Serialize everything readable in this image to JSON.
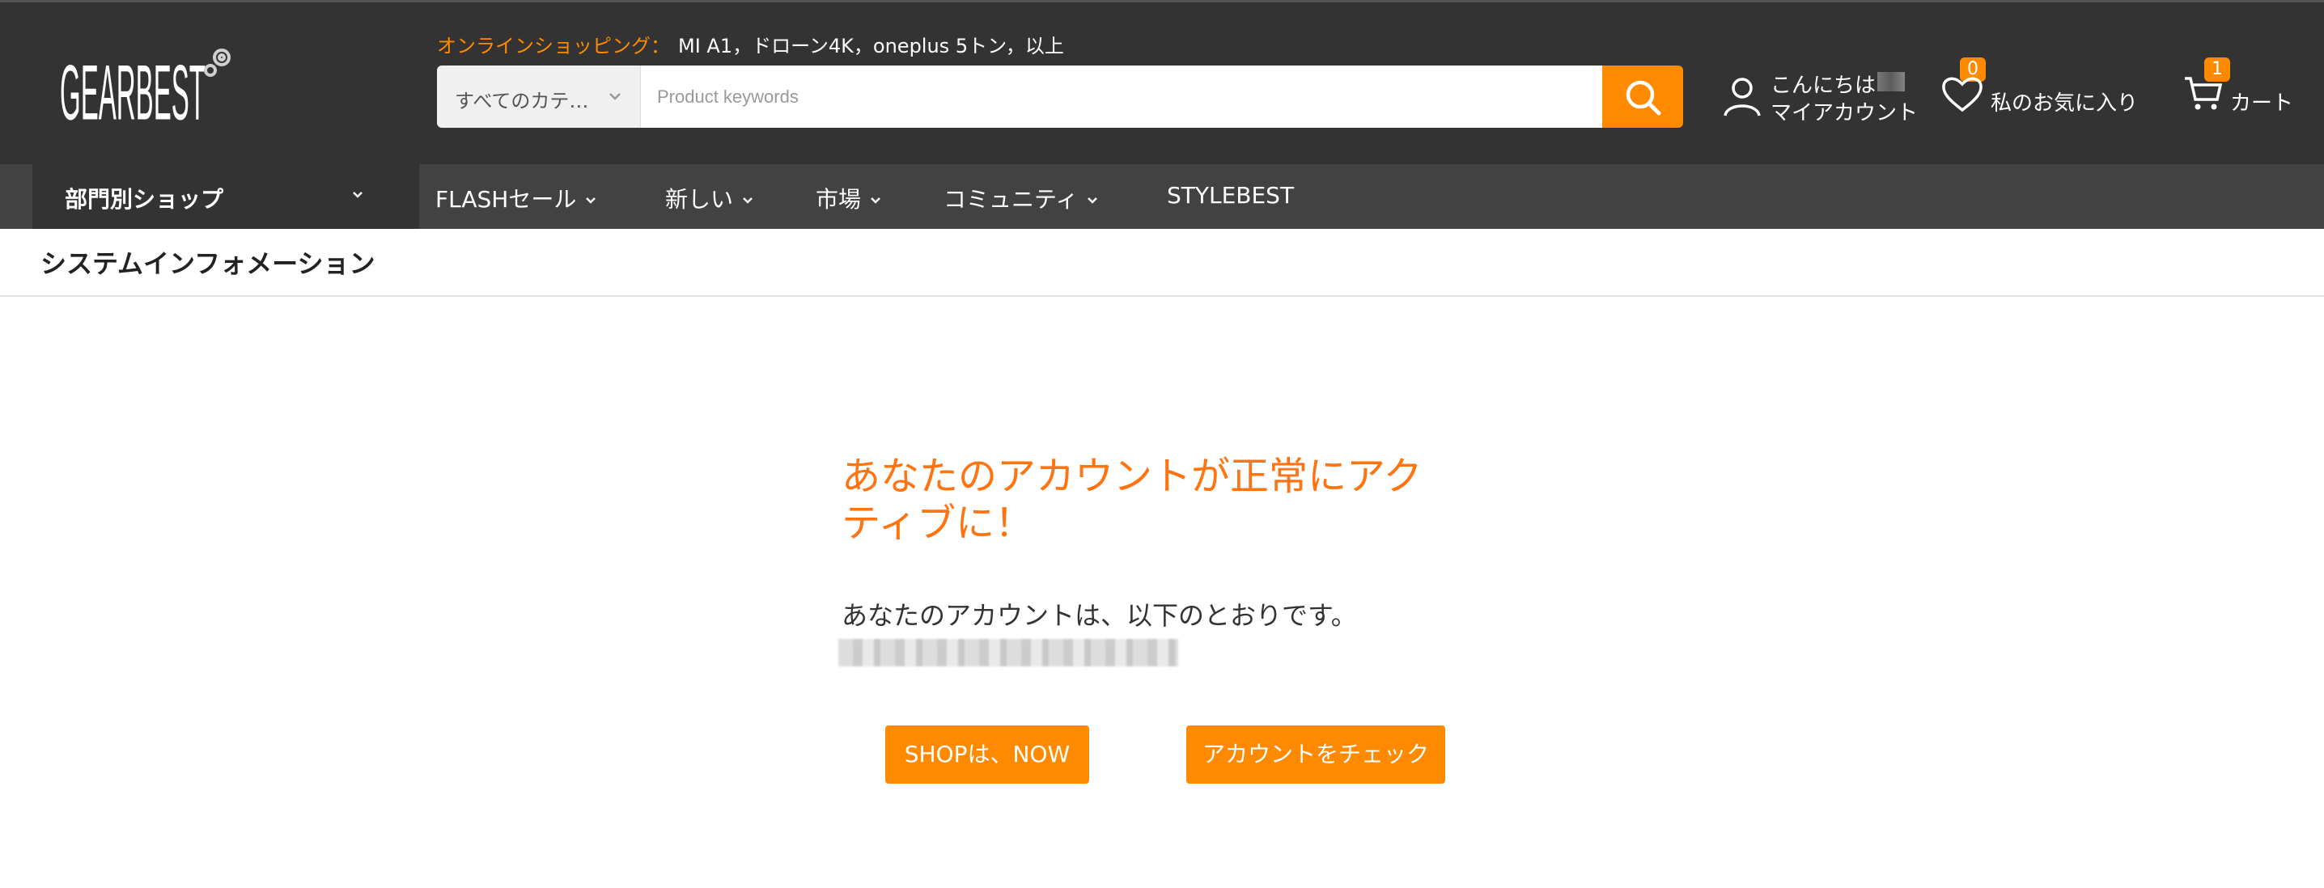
{
  "header": {
    "logo_text": "GEARBEST",
    "hot_label": "オンラインショッピング：",
    "hot_keywords": "MI A1，ドローン4K，oneplus 5トン，以上",
    "search": {
      "category": "すべてのカテ…",
      "placeholder": "Product keywords",
      "value": ""
    },
    "account": {
      "greeting": "こんにちは",
      "label": "マイアカウント"
    },
    "wishlist": {
      "label": "私のお気に入り",
      "count": "0"
    },
    "cart": {
      "label": "カート",
      "count": "1"
    }
  },
  "nav": {
    "department": "部門別ショップ",
    "items": [
      {
        "label": "FLASHセール",
        "has_dropdown": true
      },
      {
        "label": "新しい",
        "has_dropdown": true
      },
      {
        "label": "市場",
        "has_dropdown": true
      },
      {
        "label": "コミュニティ",
        "has_dropdown": true
      },
      {
        "label": "STYLEBEST",
        "has_dropdown": false
      }
    ]
  },
  "page": {
    "title": "システムインフォメーション",
    "message": "あなたのアカウントが正常にアクティブに！",
    "sub_message": "あなたのアカウントは、以下のとおりです。",
    "email": ""
  },
  "actions": {
    "shop_now": "SHOPは、NOW",
    "check_account": "アカウントをチェック"
  },
  "colors": {
    "header_bg": "#333333",
    "nav_bg": "#424242",
    "accent": "#ff8a00",
    "message": "#ff7310"
  }
}
